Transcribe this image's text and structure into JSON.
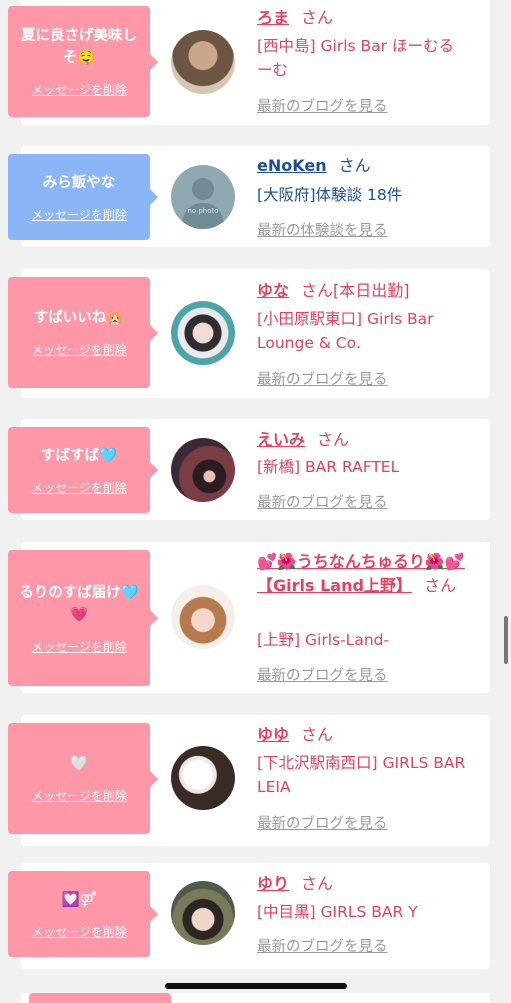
{
  "common": {
    "delete_label": "メッセージを削除",
    "san": "さん"
  },
  "items": [
    {
      "message": "夏に良さげ美味しそ🤤",
      "name": "ろま",
      "status": "",
      "shop": "[西中島] Girls Bar ほーむるーむ",
      "link": "最新のブログを見る"
    },
    {
      "message": "みら飯やな",
      "name": "eNoKen",
      "status": "",
      "shop": "[大阪府]体験談 18件",
      "link": "最新の体験談を見る",
      "avatar_text": "no photo"
    },
    {
      "message": "すばいいね🐹",
      "name": "ゆな",
      "status": "[本日出勤]",
      "shop": "[小田原駅東口] Girls Bar Lounge & Co.",
      "link": "最新のブログを見る"
    },
    {
      "message": "すばすば🩵",
      "name": "えいみ",
      "status": "",
      "shop": "[新橋] BAR RAFTEL",
      "link": "最新のブログを見る"
    },
    {
      "message": "るりのすば届け🩵💗",
      "name": "💕🌺うちなんちゅるり🌺💕【Girls Land上野】",
      "status": "",
      "shop": "[上野] Girls-Land-",
      "link": "最新のブログを見る"
    },
    {
      "message": "🤍",
      "name": "ゆゆ",
      "status": "",
      "shop": "[下北沢駅南西口] GIRLS BAR LEIA",
      "link": "最新のブログを見る"
    },
    {
      "message": "💟⚤",
      "name": "ゆり",
      "status": "",
      "shop": "[中目黒] GIRLS BAR Y",
      "link": "最新のブログを見る"
    }
  ],
  "colors": {
    "pink_bubble": "#fe98a8",
    "blue_bubble": "#8ab5f6",
    "name_pink": "#e5415f",
    "name_blue": "#1b4f9d",
    "link_gray": "#9a9a9a"
  }
}
